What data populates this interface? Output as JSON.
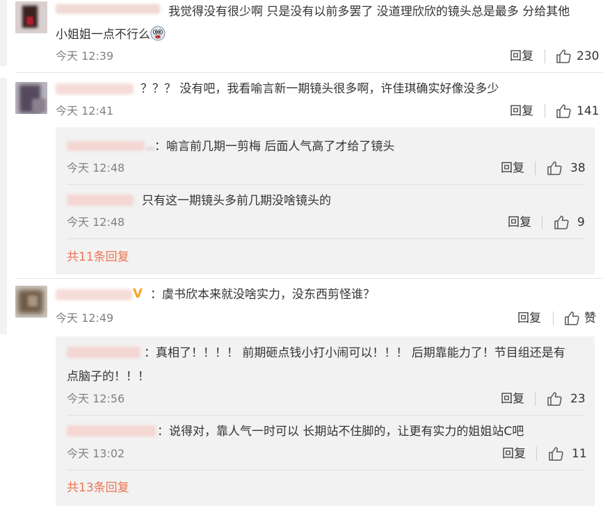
{
  "comments": [
    {
      "text_line1": "我觉得没有很少啊 只是没有以前多罢了 没道理欣欣的镜头总是最多 分给其他",
      "text_line2": "小姐姐一点不行么",
      "emoji_icon": "crazy-face-emoji",
      "time": "今天 12:39",
      "reply_label": "回复",
      "likes": "230"
    },
    {
      "text": "？？？ 没有吧，我看喻言新一期镜头很多啊，许佳琪确实好像没多少",
      "time": "今天 12:41",
      "reply_label": "回复",
      "likes": "141",
      "replies": [
        {
          "text": "：喻言前几期一剪梅 后面人气高了才给了镜头",
          "time": "今天 12:48",
          "reply_label": "回复",
          "likes": "38"
        },
        {
          "text": "只有这一期镜头多前几期没啥镜头的",
          "time": "今天 12:48",
          "reply_label": "回复",
          "likes": "9"
        }
      ],
      "more_label": "共11条回复"
    },
    {
      "badge": "V",
      "text": "：虞书欣本来就没啥实力，没东西剪怪谁？",
      "time": "今天 12:49",
      "reply_label": "回复",
      "likes": "赞",
      "replies": [
        {
          "text_line1": "：真相了！！！！ 前期砸点钱小打小闹可以！！！ 后期靠能力了！节目组还是有",
          "text_line2": "点脑子的！！！",
          "time": "今天 12:56",
          "reply_label": "回复",
          "likes": "23"
        },
        {
          "text": "：说得对，靠人气一时可以 长期站不住脚的，让更有实力的姐姐站C吧",
          "time": "今天 13:02",
          "reply_label": "回复",
          "likes": "11"
        }
      ],
      "more_label": "共13条回复"
    }
  ],
  "colors": {
    "link": "#eb7350",
    "meta": "#808080",
    "reply_bg": "#f2f2f2",
    "badge": "#f5a623"
  },
  "icons": {
    "reply_separator": "divider",
    "like": "thumbs-up-icon"
  }
}
